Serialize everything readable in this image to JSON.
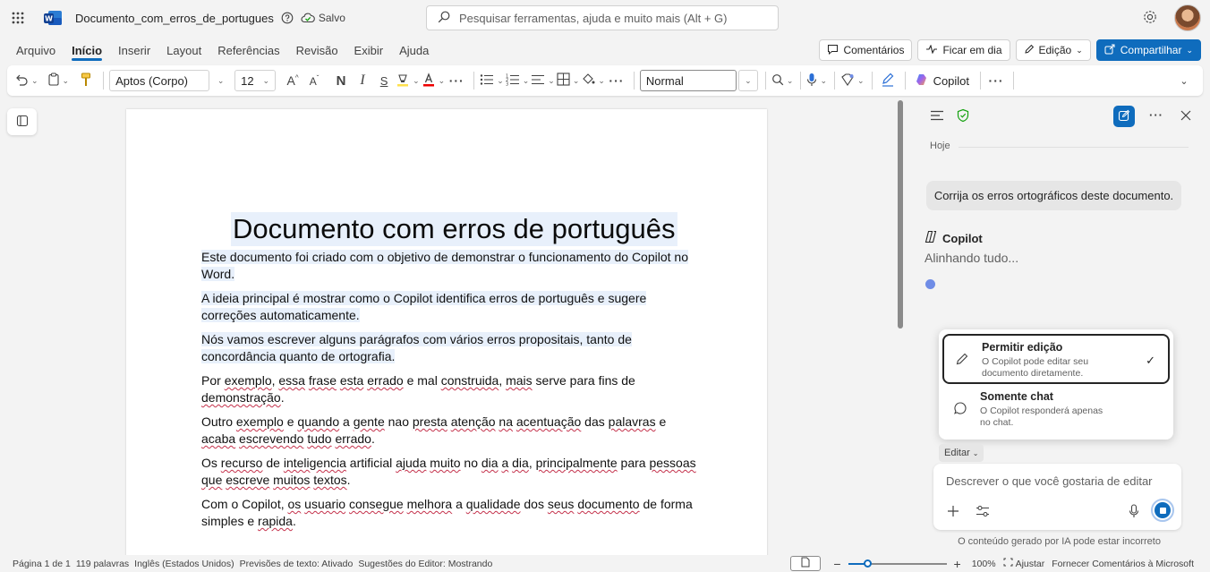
{
  "titlebar": {
    "doc_name": "Documento_com_erros_de_portugues",
    "saved": "Salvo",
    "search_placeholder": "Pesquisar ferramentas, ajuda e muito mais (Alt + G)"
  },
  "menu": {
    "items": [
      "Arquivo",
      "Início",
      "Inserir",
      "Layout",
      "Referências",
      "Revisão",
      "Exibir",
      "Ajuda"
    ],
    "active": "Início",
    "comments": "Comentários",
    "catch_up": "Ficar em dia",
    "editing": "Edição",
    "share": "Compartilhar"
  },
  "ribbon": {
    "font": "Aptos (Corpo)",
    "size": "12",
    "style": "Normal",
    "copilot": "Copilot"
  },
  "document": {
    "title": "Documento com erros de português",
    "paragraphs": [
      "Este documento foi criado com o objetivo de demonstrar o funcionamento do Copilot no Word.",
      "A ideia principal é mostrar como o Copilot identifica erros de português e sugere correções automaticamente.",
      "Nós vamos escrever alguns parágrafos com vários erros propositais, tanto de concordância quanto de ortografia."
    ],
    "p4": [
      "Por ",
      "exemplo",
      ", ",
      "essa",
      " ",
      "frase",
      " ",
      "esta",
      " ",
      "errado",
      " e mal ",
      "construida",
      ", ",
      "mais",
      " serve para fins de ",
      "demonstração",
      "."
    ],
    "p5": [
      "Outro ",
      "exemplo",
      " e ",
      "quando",
      " a ",
      "gente",
      " nao ",
      "presta",
      " ",
      "atenção",
      " ",
      "na",
      " ",
      "acentuação",
      " das ",
      "palavras",
      " e ",
      "acaba",
      " ",
      "escrevendo",
      " ",
      "tudo",
      " ",
      "errado",
      "."
    ],
    "p6": [
      "Os ",
      "recurso",
      " de ",
      "inteligencia",
      " artificial ",
      "ajuda",
      " ",
      "muito",
      " no ",
      "dia",
      " ",
      "a",
      " ",
      "dia",
      ", ",
      "principalmente",
      " para ",
      "pessoas",
      " ",
      "que",
      " ",
      "escreve",
      " ",
      "muitos",
      " ",
      "textos",
      "."
    ],
    "p7": [
      "Com o Copilot, ",
      "os",
      " ",
      "usuario",
      " ",
      "consegue",
      " ",
      "melhora",
      " a ",
      "qualidade",
      " dos ",
      "seus",
      " ",
      "documento",
      " de forma simples e ",
      "rapida",
      "."
    ]
  },
  "copilot_pane": {
    "today": "Hoje",
    "user_message": "Corrija os erros ortográficos deste documento.",
    "copilot_name": "Copilot",
    "status": "Alinhando tudo...",
    "modes": [
      {
        "title": "Permitir edição",
        "desc": "O Copilot pode editar seu documento diretamente.",
        "selected": true
      },
      {
        "title": "Somente chat",
        "desc": "O Copilot responderá apenas no chat.",
        "selected": false
      }
    ],
    "mode_button": "Editar",
    "input_placeholder": "Descrever o que você gostaria de editar",
    "disclaimer": "O conteúdo gerado por IA pode estar incorreto"
  },
  "statusbar": {
    "page": "Página 1 de 1",
    "words": "119 palavras",
    "language": "Inglês (Estados Unidos)",
    "predictions": "Previsões de texto: Ativado",
    "suggestions": "Sugestões do Editor: Mostrando",
    "zoom": "100%",
    "fit": "Ajustar",
    "feedback": "Fornecer Comentários à Microsoft",
    "zoom_fraction": 0.2
  },
  "colors": {
    "accent": "#0f6cbd",
    "error_underline": "#c4314b",
    "highlight": "#e8f0fb",
    "copilot_dot": "#6f8ce6"
  }
}
